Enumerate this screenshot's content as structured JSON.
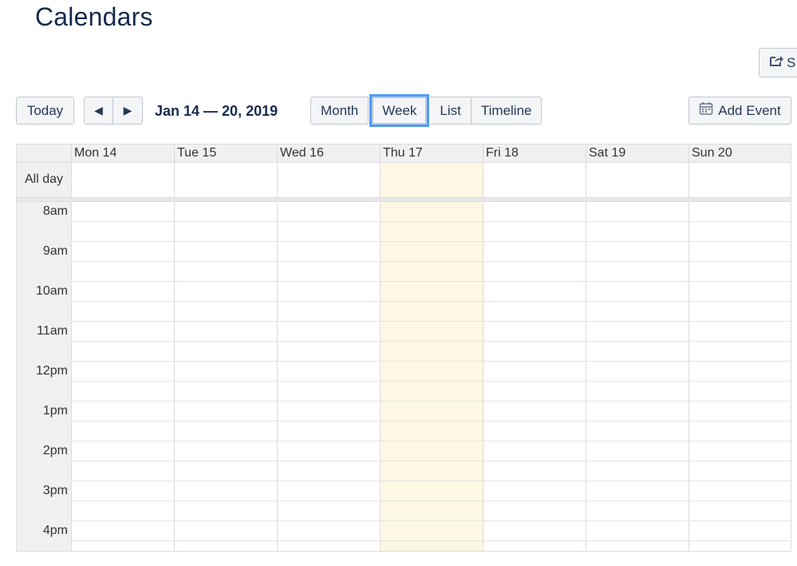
{
  "page": {
    "title": "Calendars"
  },
  "toolbar": {
    "share_label": "S",
    "today_label": "Today",
    "prev_glyph": "◀",
    "next_glyph": "▶",
    "range_title": "Jan 14 — 20, 2019",
    "views": [
      "Month",
      "Week",
      "List",
      "Timeline"
    ],
    "active_view": "Week",
    "add_event_label": "Add Event"
  },
  "calendar": {
    "all_day_label": "All day",
    "days": [
      "Mon 14",
      "Tue 15",
      "Wed 16",
      "Thu 17",
      "Fri 18",
      "Sat 19",
      "Sun 20"
    ],
    "today_day": "Thu 17",
    "times": [
      "8am",
      "9am",
      "10am",
      "11am",
      "12pm",
      "1pm",
      "2pm",
      "3pm",
      "4pm"
    ],
    "today_highlight_color": "#fcf8e3",
    "active_focus_color": "#4c9aff"
  }
}
